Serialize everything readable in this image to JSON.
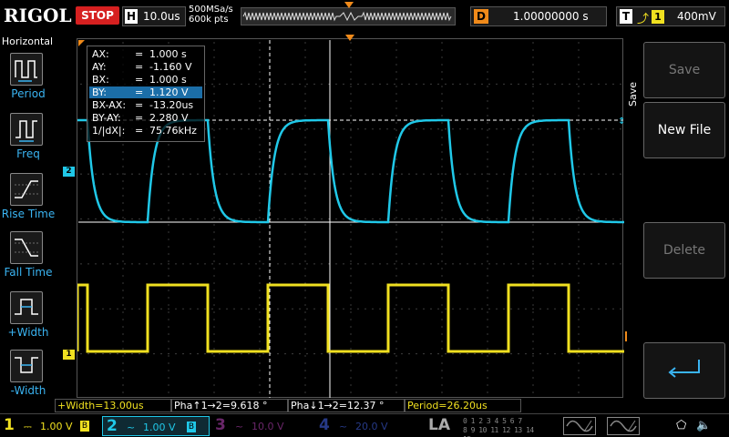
{
  "header": {
    "brand": "RIGOL",
    "run_state": "STOP",
    "timebase_label": "H",
    "timebase": "10.0us",
    "sample_rate": "500MSa/s",
    "memory_depth": "600k pts",
    "delay_label": "D",
    "delay": "1.00000000 s",
    "trigger_label": "T",
    "trigger_channel": "1",
    "trigger_level": "400mV"
  },
  "left_menu": {
    "title": "Horizontal",
    "items": [
      {
        "label": "Period",
        "icon": "period-icon"
      },
      {
        "label": "Freq",
        "icon": "frequency-icon"
      },
      {
        "label": "Rise Time",
        "icon": "rise-time-icon"
      },
      {
        "label": "Fall Time",
        "icon": "fall-time-icon"
      },
      {
        "label": "+Width",
        "icon": "positive-width-icon"
      },
      {
        "label": "-Width",
        "icon": "negative-width-icon"
      }
    ]
  },
  "cursor_panel": {
    "rows": [
      {
        "key": "AX:",
        "value": "1.000 s"
      },
      {
        "key": "AY:",
        "value": "-1.160 V"
      },
      {
        "key": "BX:",
        "value": "1.000 s"
      },
      {
        "key": "BY:",
        "value": "1.120 V",
        "selected": true
      },
      {
        "key": "BX-AX:",
        "value": "-13.20us"
      },
      {
        "key": "BY-AY:",
        "value": "2.280 V"
      },
      {
        "key": "1/|dX|:",
        "value": "75.76kHz"
      }
    ]
  },
  "markers": {
    "ch2": "2",
    "ch1": "1",
    "trigger_level": "T"
  },
  "right_panel": {
    "section": "Save",
    "buttons": [
      {
        "label": "Save",
        "enabled": false
      },
      {
        "label": "New File",
        "enabled": true
      },
      {
        "label": "Delete",
        "enabled": false
      },
      {
        "label": "",
        "enabled": true,
        "icon": "return-icon"
      }
    ]
  },
  "measurements": [
    {
      "text": "+Width=13.00us"
    },
    {
      "text": "Pha↑1→2=9.618 °"
    },
    {
      "text": "Pha↓1→2=12.37 °"
    },
    {
      "text": "Period=26.20us"
    }
  ],
  "channels": [
    {
      "num": "1",
      "coupling": "⎓",
      "scale": "1.00 V",
      "bw": "B"
    },
    {
      "num": "2",
      "coupling": "~",
      "scale": "1.00 V",
      "bw": "B"
    },
    {
      "num": "3",
      "coupling": "~",
      "scale": "10.0 V"
    },
    {
      "num": "4",
      "coupling": "~",
      "scale": "20.0 V"
    }
  ],
  "bottom": {
    "la_label": "LA",
    "digital_row1": "0 1 2 3  4 5 6 7",
    "digital_row2": "8 9 10 11  12 13 14 15"
  },
  "colors": {
    "ch1": "#f0e020",
    "ch2": "#20c8e8",
    "accent": "#f08a1a",
    "stop": "#d62020"
  }
}
